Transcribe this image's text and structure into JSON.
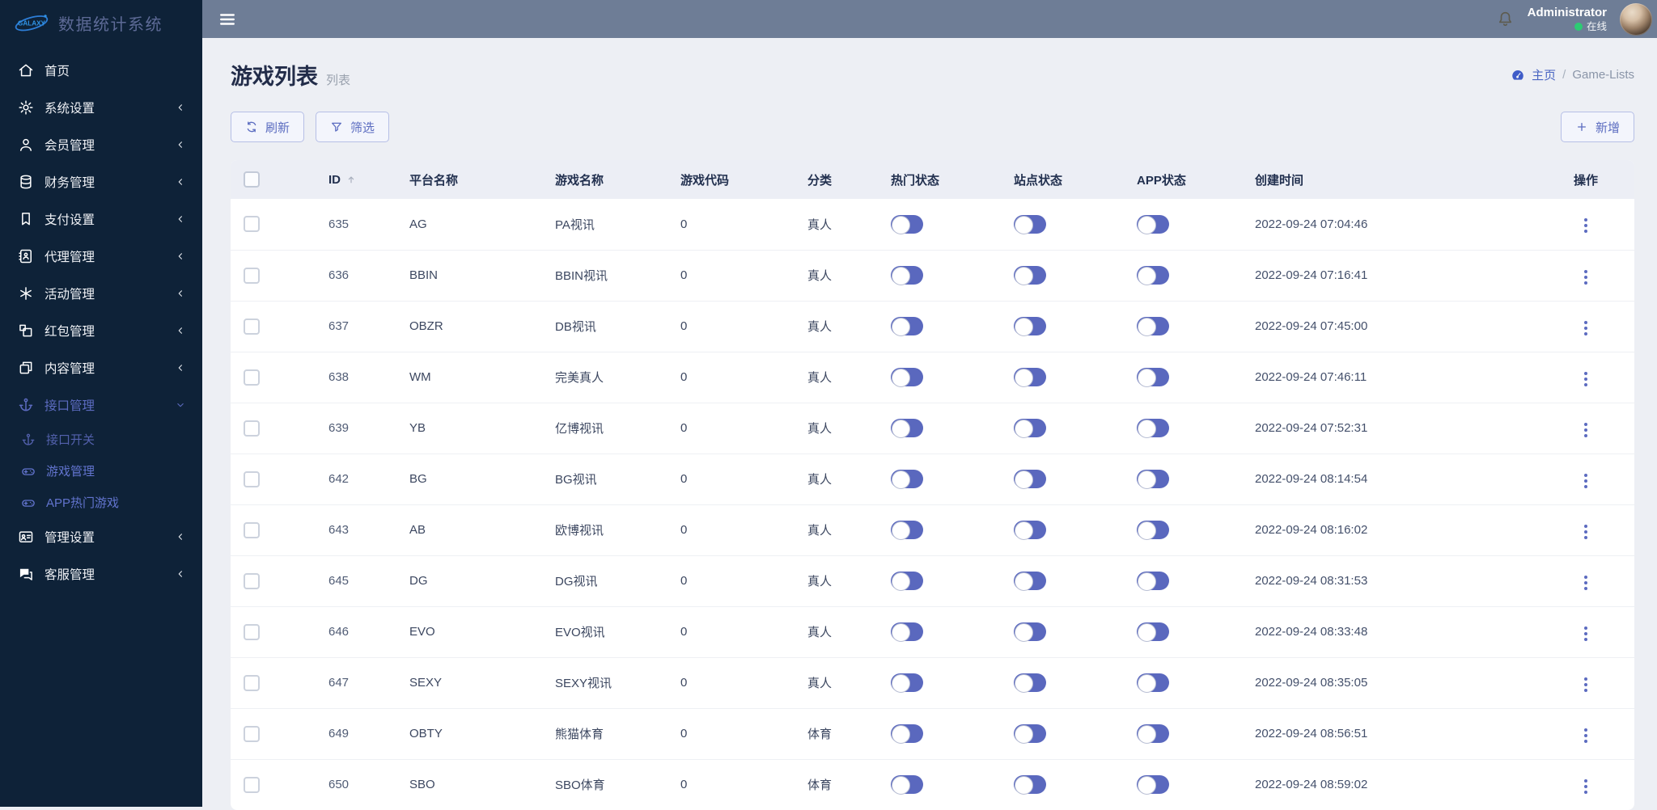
{
  "app": {
    "logo_text": "GALAXY",
    "title": "数据统计系统"
  },
  "topbar": {
    "user_name": "Administrator",
    "user_status": "在线"
  },
  "page": {
    "title": "游戏列表",
    "subtitle": "列表",
    "breadcrumb": {
      "home": "主页",
      "separator": "/",
      "current": "Game-Lists"
    }
  },
  "toolbar": {
    "refresh": "刷新",
    "filter": "筛选",
    "add": "新增"
  },
  "sidebar": {
    "items": [
      {
        "key": "home",
        "icon": "home",
        "label": "首页",
        "chevron": null,
        "active": false
      },
      {
        "key": "system-settings",
        "icon": "gears",
        "label": "系统设置",
        "chevron": "left",
        "active": false
      },
      {
        "key": "member-management",
        "icon": "user",
        "label": "会员管理",
        "chevron": "left",
        "active": false
      },
      {
        "key": "finance-management",
        "icon": "database",
        "label": "财务管理",
        "chevron": "left",
        "active": false
      },
      {
        "key": "payment-settings",
        "icon": "bookmark",
        "label": "支付设置",
        "chevron": "left",
        "active": false
      },
      {
        "key": "agent-management",
        "icon": "address-book",
        "label": "代理管理",
        "chevron": "left",
        "active": false
      },
      {
        "key": "activity-management",
        "icon": "asterisk",
        "label": "活动管理",
        "chevron": "left",
        "active": false
      },
      {
        "key": "redpacket-management",
        "icon": "box",
        "label": "红包管理",
        "chevron": "left",
        "active": false
      },
      {
        "key": "content-management",
        "icon": "copy",
        "label": "内容管理",
        "chevron": "left",
        "active": false
      },
      {
        "key": "interface-management",
        "icon": "anchor",
        "label": "接口管理",
        "chevron": "down",
        "active": true,
        "submenu": [
          {
            "key": "interface-switch",
            "icon": "anchor",
            "label": "接口开关",
            "active": false
          },
          {
            "key": "game-management",
            "icon": "gamepad",
            "label": "游戏管理",
            "active": true
          },
          {
            "key": "app-hot-games",
            "icon": "gamepad",
            "label": "APP热门游戏",
            "active": true
          }
        ]
      },
      {
        "key": "admin-settings",
        "icon": "id-card",
        "label": "管理设置",
        "chevron": "left",
        "active": false
      },
      {
        "key": "service-management",
        "icon": "comments",
        "label": "客服管理",
        "chevron": "left",
        "active": false
      }
    ]
  },
  "table": {
    "columns": [
      "ID",
      "平台名称",
      "游戏名称",
      "游戏代码",
      "分类",
      "热门状态",
      "站点状态",
      "APP状态",
      "创建时间",
      "操作"
    ],
    "rows": [
      {
        "id": "635",
        "platform": "AG",
        "game": "PA视讯",
        "code": "0",
        "category": "真人",
        "hot": false,
        "site": false,
        "app": false,
        "created": "2022-09-24 07:04:46"
      },
      {
        "id": "636",
        "platform": "BBIN",
        "game": "BBIN视讯",
        "code": "0",
        "category": "真人",
        "hot": false,
        "site": false,
        "app": false,
        "created": "2022-09-24 07:16:41"
      },
      {
        "id": "637",
        "platform": "OBZR",
        "game": "DB视讯",
        "code": "0",
        "category": "真人",
        "hot": false,
        "site": false,
        "app": false,
        "created": "2022-09-24 07:45:00"
      },
      {
        "id": "638",
        "platform": "WM",
        "game": "完美真人",
        "code": "0",
        "category": "真人",
        "hot": false,
        "site": false,
        "app": false,
        "created": "2022-09-24 07:46:11"
      },
      {
        "id": "639",
        "platform": "YB",
        "game": "亿博视讯",
        "code": "0",
        "category": "真人",
        "hot": false,
        "site": false,
        "app": false,
        "created": "2022-09-24 07:52:31"
      },
      {
        "id": "642",
        "platform": "BG",
        "game": "BG视讯",
        "code": "0",
        "category": "真人",
        "hot": false,
        "site": false,
        "app": false,
        "created": "2022-09-24 08:14:54"
      },
      {
        "id": "643",
        "platform": "AB",
        "game": "欧博视讯",
        "code": "0",
        "category": "真人",
        "hot": false,
        "site": false,
        "app": false,
        "created": "2022-09-24 08:16:02"
      },
      {
        "id": "645",
        "platform": "DG",
        "game": "DG视讯",
        "code": "0",
        "category": "真人",
        "hot": false,
        "site": false,
        "app": false,
        "created": "2022-09-24 08:31:53"
      },
      {
        "id": "646",
        "platform": "EVO",
        "game": "EVO视讯",
        "code": "0",
        "category": "真人",
        "hot": false,
        "site": false,
        "app": false,
        "created": "2022-09-24 08:33:48"
      },
      {
        "id": "647",
        "platform": "SEXY",
        "game": "SEXY视讯",
        "code": "0",
        "category": "真人",
        "hot": false,
        "site": false,
        "app": false,
        "created": "2022-09-24 08:35:05"
      },
      {
        "id": "649",
        "platform": "OBTY",
        "game": "熊猫体育",
        "code": "0",
        "category": "体育",
        "hot": false,
        "site": false,
        "app": false,
        "created": "2022-09-24 08:56:51"
      },
      {
        "id": "650",
        "platform": "SBO",
        "game": "SBO体育",
        "code": "0",
        "category": "体育",
        "hot": false,
        "site": false,
        "app": false,
        "created": "2022-09-24 08:59:02"
      }
    ]
  },
  "colors": {
    "accent": "#5c6bc0",
    "sidebar_bg": "#0e2238",
    "topbar_bg": "#6e7d96",
    "page_bg": "#edeff4",
    "table_header_bg": "#eceef5",
    "status_green": "#2dcb73",
    "toggle_track": "#5a68be"
  }
}
